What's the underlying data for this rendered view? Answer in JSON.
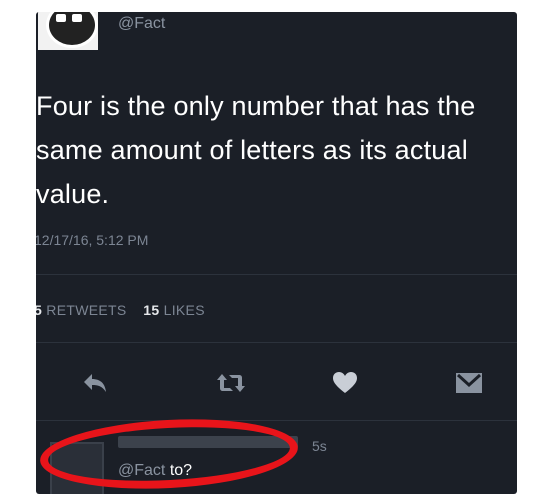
{
  "tweet": {
    "handle": "@Fact",
    "text": "Four is the only number that has the same amount of letters as its actual value.",
    "timestamp": "12/17/16, 5:12 PM",
    "retweets_count": "5",
    "retweets_label": "RETWEETS",
    "likes_count": "15",
    "likes_label": "LIKES"
  },
  "actions": {
    "icons": [
      "reply-icon",
      "retweet-icon",
      "heart-icon",
      "message-icon"
    ]
  },
  "reply": {
    "mention": "@Fact",
    "text": "to?",
    "time": "5s"
  },
  "colors": {
    "background": "#1b1f27",
    "text": "#ffffff",
    "muted": "#7c8593",
    "annotation": "#e8141a"
  }
}
